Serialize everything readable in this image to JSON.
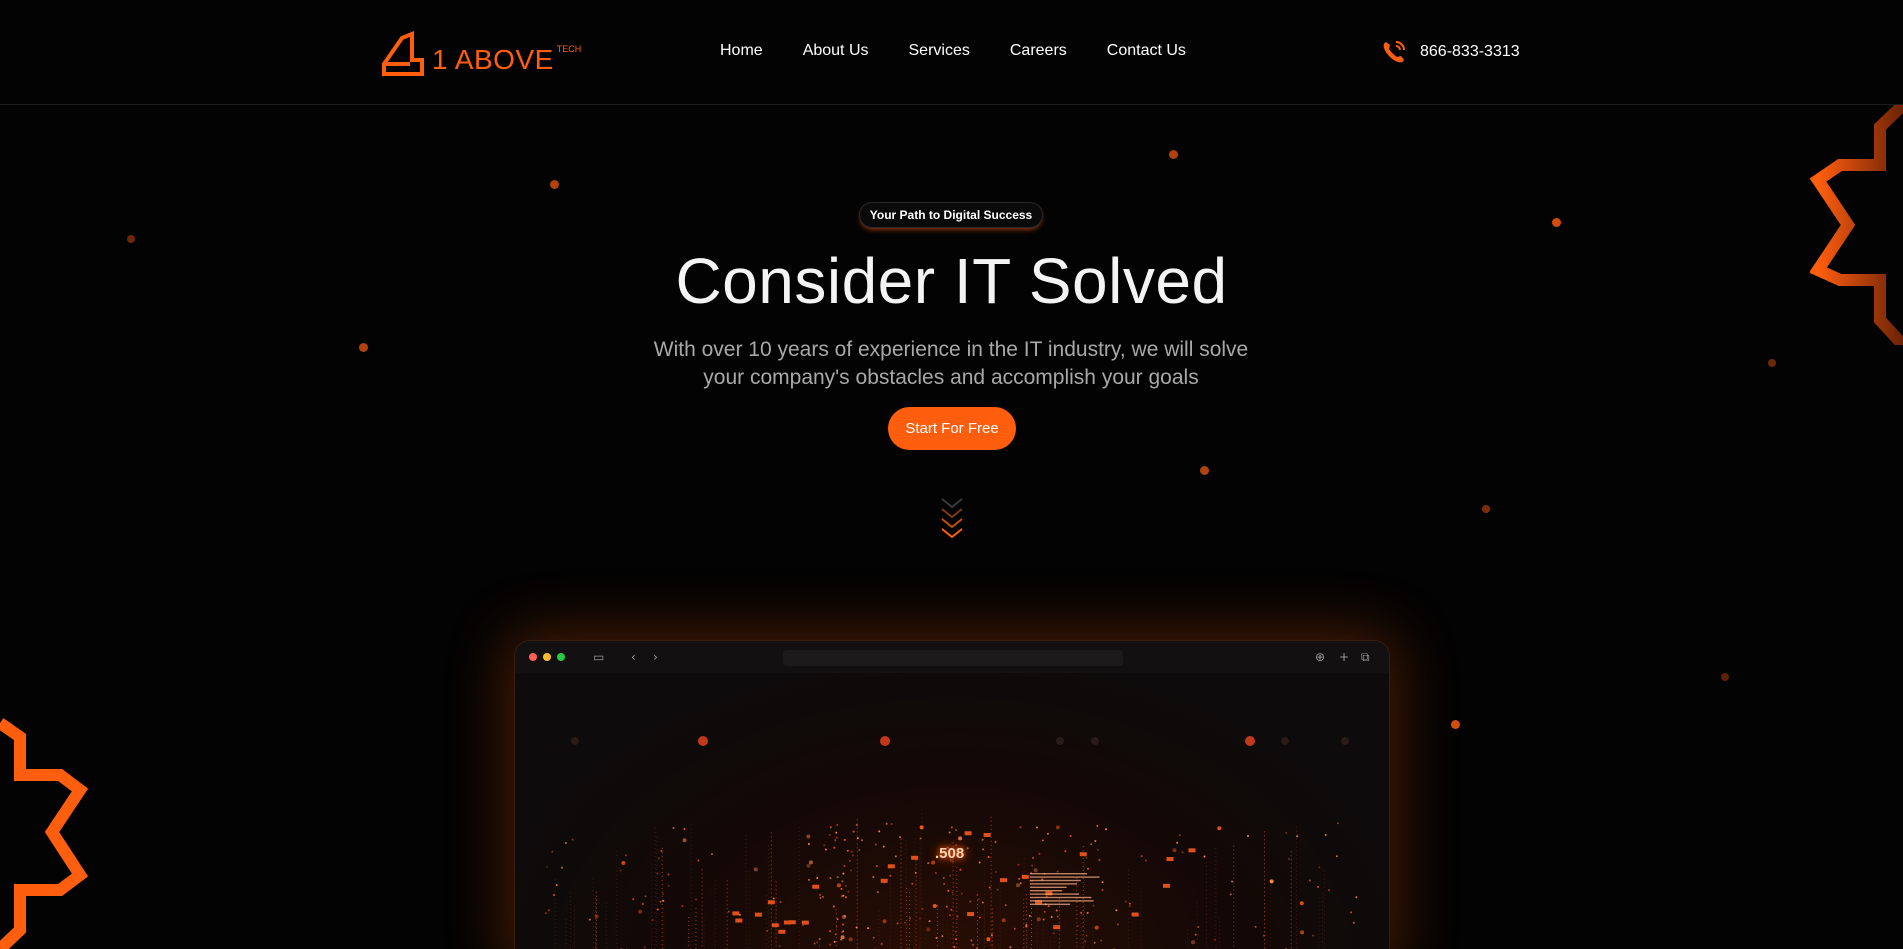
{
  "brand": {
    "name": "1 ABOVE",
    "sup": "TECH",
    "accent": "#ff5e0e"
  },
  "nav": {
    "items": [
      "Home",
      "About Us",
      "Services",
      "Careers",
      "Contact Us"
    ]
  },
  "contact": {
    "phone": "866-833-3313"
  },
  "hero": {
    "badge": "Your Path to Digital Success",
    "title": "Consider IT Solved",
    "subtitle": "With over 10 years of experience in the IT industry, we will solve your company's obstacles and accomplish your goals",
    "cta": "Start For Free"
  },
  "browser": {
    "counter": ".508"
  }
}
